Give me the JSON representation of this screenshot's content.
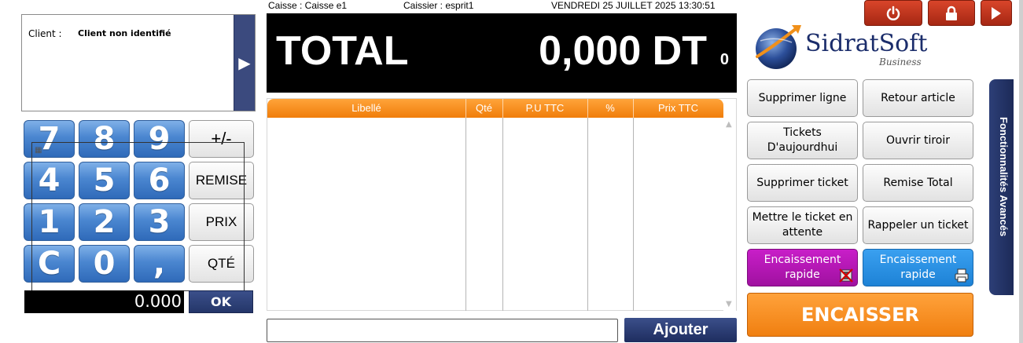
{
  "header": {
    "caisse": "Caisse : Caisse e1",
    "caissier": "Caissier : esprit1",
    "datetime": "VENDREDI 25 JUILLET 2025 13:30:51"
  },
  "client": {
    "label": "Client :",
    "value": "Client non identifié",
    "arrow": "▶"
  },
  "total": {
    "label": "TOTAL",
    "amount": "0,000 DT",
    "count": "0"
  },
  "table": {
    "columns": [
      "Libellé",
      "Qté",
      "P.U TTC",
      "%",
      "Prix TTC"
    ],
    "rows": []
  },
  "keypad": {
    "keys": [
      "7",
      "8",
      "9",
      "4",
      "5",
      "6",
      "1",
      "2",
      "3",
      "C",
      "0",
      ","
    ],
    "functions": {
      "sign": "+/-",
      "remise": "REMISE",
      "prix": "PRIX",
      "qte": "QTÉ"
    },
    "display": "0.000",
    "ok": "OK"
  },
  "search": {
    "value": "",
    "ajouter": "Ajouter"
  },
  "logo": {
    "name": "SidratSoft",
    "sub": "Business"
  },
  "top_buttons": {
    "power": "power-icon",
    "lock": "lock-icon",
    "play": "play-icon"
  },
  "actions": {
    "supprimer_ligne": "Supprimer ligne",
    "retour_article": "Retour article",
    "tickets_aujourdhui": "Tickets D'aujourdhui",
    "ouvrir_tiroir": "Ouvrir tiroir",
    "supprimer_ticket": "Supprimer ticket",
    "remise_total": "Remise Total",
    "mettre_attente": "Mettre le ticket en attente",
    "rappeler_ticket": "Rappeler un ticket",
    "encaissement_rapide_1": "Encaissement rapide",
    "encaissement_rapide_2": "Encaissement rapide",
    "encaisser": "ENCAISSER"
  },
  "side_panel": {
    "label": "Fonctionnalités Avancés"
  },
  "colors": {
    "accent_orange": "#f07d0a",
    "navy": "#1e2d5f",
    "key_blue": "#4a86d0",
    "power_red": "#c23a22",
    "magenta": "#b418b4",
    "sky_blue": "#2a90e2"
  }
}
